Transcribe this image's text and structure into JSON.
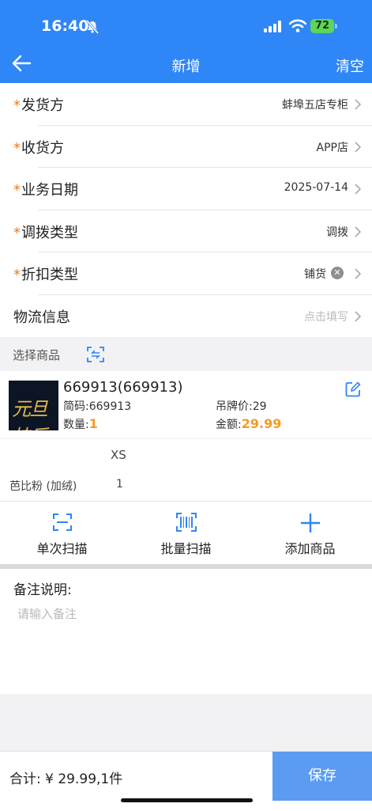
{
  "status": {
    "time": "16:40",
    "battery": "72"
  },
  "nav": {
    "title": "新增",
    "clear": "清空"
  },
  "form": {
    "rows": [
      {
        "label": "发货方",
        "required": true,
        "value": "蚌埠五店专柜"
      },
      {
        "label": "收货方",
        "required": true,
        "value": "APP店"
      },
      {
        "label": "业务日期",
        "required": true,
        "value": "2025-07-14"
      },
      {
        "label": "调拨类型",
        "required": true,
        "value": "调拨"
      },
      {
        "label": "折扣类型",
        "required": true,
        "value": "铺货"
      },
      {
        "label": "物流信息",
        "required": false,
        "value": "点击填写"
      }
    ]
  },
  "select_goods": {
    "label": "选择商品"
  },
  "product": {
    "name": "669913(669913)",
    "code": "简码:669913",
    "tag_price": "吊牌价:29",
    "qty_label": "数量:",
    "qty": "1",
    "amount_label": "金额:",
    "amount": "29.99",
    "size_header": "XS",
    "color": "芭比粉 (加绒)",
    "color_qty": "1"
  },
  "actions": [
    {
      "label": "单次扫描",
      "icon": "single-scan-icon"
    },
    {
      "label": "批量扫描",
      "icon": "barcode-icon"
    },
    {
      "label": "添加商品",
      "icon": "plus-icon"
    }
  ],
  "note": {
    "title": "备注说明:",
    "placeholder": "请输入备注"
  },
  "footer": {
    "total": "合计: ¥ 29.99,1件",
    "save": "保存"
  },
  "colors": {
    "primary": "#2f86f6",
    "accent": "#f59a23",
    "save": "#5b9cf2"
  }
}
